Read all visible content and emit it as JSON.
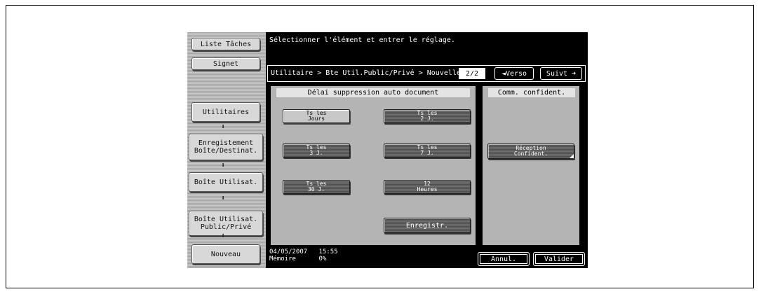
{
  "prompt": "Sélectionner l'élément et entrer le réglage.",
  "sidebar": {
    "job_list": "Liste Tâches",
    "bookmark": "Signet",
    "steps": [
      "Utilitaires",
      "Enregistement\nBoîte/Destinat.",
      "Boîte Utilisat.",
      "Boîte Utilisat.\nPublic/Privé",
      "Nouveau"
    ],
    "arrow_icon": "down-arrow-icon"
  },
  "breadcrumb": "Utilitaire > Bte Util.Public/Privé > Nouvelle",
  "page": "2/2",
  "nav": {
    "prev": "◄Verso",
    "next": "Suivt ➜"
  },
  "left_panel": {
    "title": "Délai suppression auto document",
    "options": [
      "Ts les\nJours",
      "Ts les\n2 J.",
      "Ts les\n3 J.",
      "Ts les\n7 J.",
      "Ts les\n30 J.",
      "12\nHeures"
    ],
    "selected": "Ts les\nJours",
    "register": "Enregistr."
  },
  "right_panel": {
    "title": "Comm. confident.",
    "option": "Réception\nConfident."
  },
  "status": {
    "datetime": "04/05/2007   15:55",
    "memory": "Mémoire      0%"
  },
  "buttons": {
    "cancel": "Annul.",
    "ok": "Valider"
  },
  "colors": {
    "screen_bg": "#000000",
    "panel_bg": "#b4b4b4",
    "button_dark": "#5f5f5f"
  }
}
